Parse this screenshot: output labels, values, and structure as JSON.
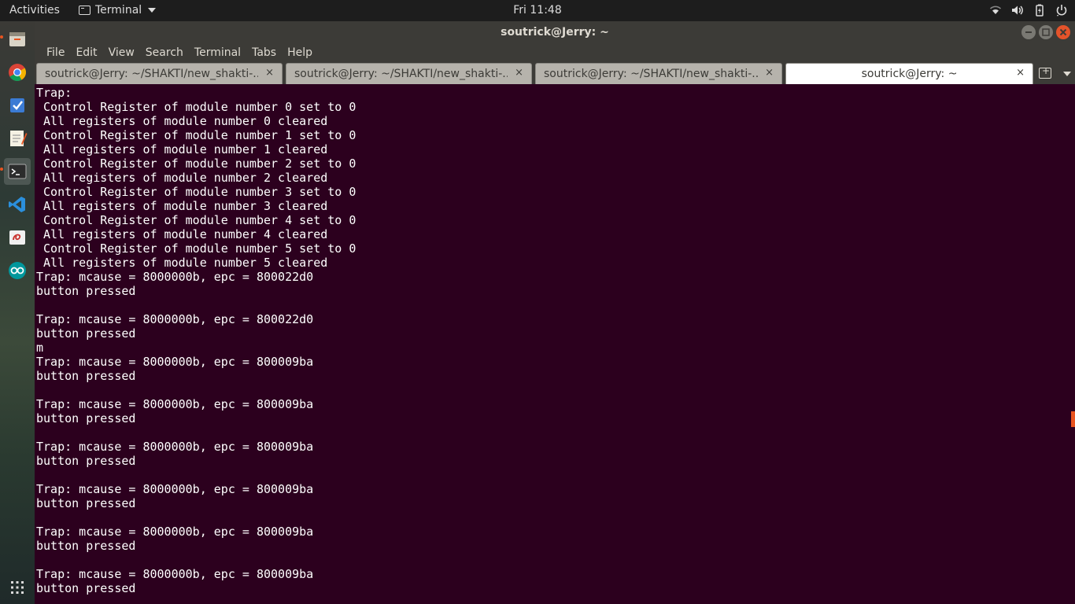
{
  "topbar": {
    "activities": "Activities",
    "app_name": "Terminal",
    "clock": "Fri 11:48",
    "status_icons": [
      "wifi-icon",
      "volume-icon",
      "battery-icon",
      "power-icon"
    ]
  },
  "dock": {
    "items": [
      "files-icon",
      "chrome-icon",
      "tasks-icon",
      "text-editor-icon",
      "terminal-icon",
      "vscode-icon",
      "document-viewer-icon",
      "arduino-icon"
    ],
    "apps_grid": "show-applications-icon"
  },
  "window": {
    "title": "soutrick@Jerry: ~"
  },
  "menubar": {
    "items": [
      "File",
      "Edit",
      "View",
      "Search",
      "Terminal",
      "Tabs",
      "Help"
    ]
  },
  "tabs": [
    {
      "label": "soutrick@Jerry: ~/SHAKTI/new_shakti-...",
      "close": "×"
    },
    {
      "label": "soutrick@Jerry: ~/SHAKTI/new_shakti-...",
      "close": "×"
    },
    {
      "label": "soutrick@Jerry: ~/SHAKTI/new_shakti-...",
      "close": "×"
    },
    {
      "label": "soutrick@Jerry: ~",
      "close": "×"
    }
  ],
  "terminal": {
    "lines": [
      "Trap:",
      " Control Register of module number 0 set to 0",
      " All registers of module number 0 cleared",
      " Control Register of module number 1 set to 0",
      " All registers of module number 1 cleared",
      " Control Register of module number 2 set to 0",
      " All registers of module number 2 cleared",
      " Control Register of module number 3 set to 0",
      " All registers of module number 3 cleared",
      " Control Register of module number 4 set to 0",
      " All registers of module number 4 cleared",
      " Control Register of module number 5 set to 0",
      " All registers of module number 5 cleared",
      "Trap: mcause = 8000000b, epc = 800022d0",
      "button pressed",
      "",
      "Trap: mcause = 8000000b, epc = 800022d0",
      "button pressed",
      "m",
      "Trap: mcause = 8000000b, epc = 800009ba",
      "button pressed",
      "",
      "Trap: mcause = 8000000b, epc = 800009ba",
      "button pressed",
      "",
      "Trap: mcause = 8000000b, epc = 800009ba",
      "button pressed",
      "",
      "Trap: mcause = 8000000b, epc = 800009ba",
      "button pressed",
      "",
      "Trap: mcause = 8000000b, epc = 800009ba",
      "button pressed",
      "",
      "Trap: mcause = 8000000b, epc = 800009ba",
      "button pressed"
    ]
  },
  "colors": {
    "terminal_bg": "#2c001e",
    "topbar_bg": "#1d1d1d",
    "window_chrome": "#3c3b37",
    "accent": "#e95420"
  }
}
